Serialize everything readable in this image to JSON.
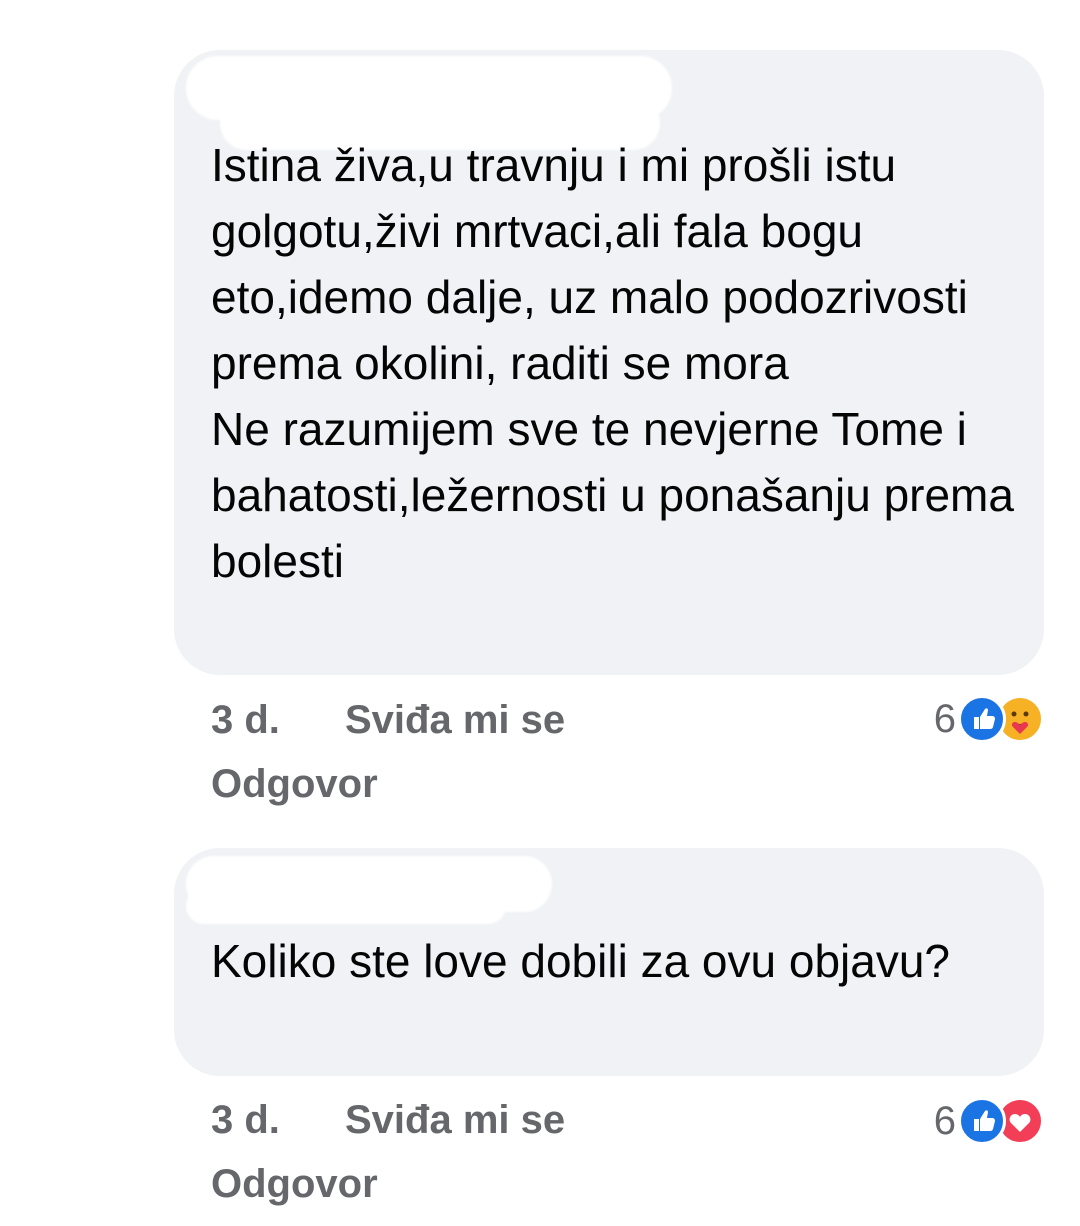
{
  "comments": [
    {
      "text": "Istina živa,u travnju i mi prošli istu golgotu,živi mrtvaci,ali fala bogu eto,idemo dalje, uz malo podozrivosti prema okolini, raditi se mora\nNe razumijem sve te nevjerne Tome i bahatosti,ležernosti u ponašanju prema bolesti",
      "time": "3 d.",
      "like_label": "Sviđa mi se",
      "reply_label": "Odgovor",
      "reaction_count": "6",
      "reactions": [
        "like-icon",
        "care-icon"
      ]
    },
    {
      "text": "Koliko ste love dobili za ovu objavu?",
      "time": "3 d.",
      "like_label": "Sviđa mi se",
      "reply_label": "Odgovor",
      "reaction_count": "6",
      "reactions": [
        "like-icon",
        "love-icon"
      ]
    }
  ],
  "colors": {
    "bubble": "#f0f2f5",
    "meta_text": "#65676b",
    "like": "#1b74e4",
    "care": "#f7b125",
    "love": "#f33e58"
  }
}
